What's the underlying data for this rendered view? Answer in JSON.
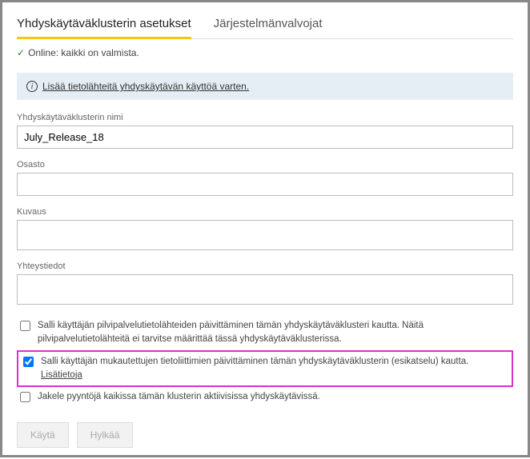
{
  "tabs": {
    "settings": "Yhdyskäytäväklusterin asetukset",
    "admins": "Järjestelmänvalvojat"
  },
  "status": {
    "text": "Online: kaikki on valmista."
  },
  "infobar": {
    "text": "Lisää tietolähteitä yhdyskäytävän käyttöä varten."
  },
  "fields": {
    "name_label": "Yhdyskäytäväklusterin nimi",
    "name_value": "July_Release_18",
    "dept_label": "Osasto",
    "dept_value": "",
    "desc_label": "Kuvaus",
    "desc_value": "",
    "contact_label": "Yhteystiedot",
    "contact_value": ""
  },
  "checks": {
    "cloud": "Salli käyttäjän pilvipalvelutietolähteiden päivittäminen tämän yhdyskäytäväklusteri kautta. Näitä pilvipalvelutietolähteitä ei tarvitse määrittää tässä yhdyskäytäväklusterissa.",
    "custom": "Salli käyttäjän mukautettujen tietoliittimien päivittäminen tämän yhdyskäytäväklusterin (esikatselu) kautta.",
    "custom_learn": "Lisätietoja",
    "distribute": "Jakele pyyntöjä kaikissa tämän klusterin aktiivisissa yhdyskäytävissä."
  },
  "buttons": {
    "apply": "Käytä",
    "discard": "Hylkää"
  }
}
